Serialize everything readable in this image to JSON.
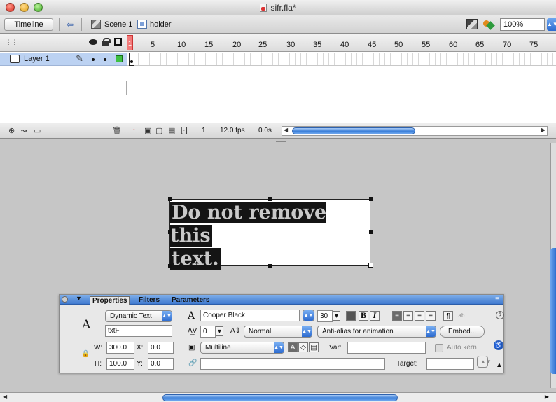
{
  "window": {
    "title": "sifr.fla*"
  },
  "nav": {
    "timeline_label": "Timeline",
    "breadcrumbs": [
      {
        "label": "Scene 1"
      },
      {
        "label": "holder"
      }
    ],
    "zoom": "100%"
  },
  "timeline": {
    "frame_numbers": [
      "1",
      "5",
      "10",
      "15",
      "20",
      "25",
      "30",
      "35",
      "40",
      "45",
      "50",
      "55",
      "60",
      "65",
      "70",
      "75"
    ],
    "layers": [
      {
        "name": "Layer 1"
      }
    ],
    "current_frame": "1",
    "frame_rate": "12.0 fps",
    "elapsed_time": "0.0s"
  },
  "stage": {
    "text_line1": "Do not remove this",
    "text_line2": "text."
  },
  "properties": {
    "tabs": [
      "Properties",
      "Filters",
      "Parameters"
    ],
    "text_type": "Dynamic Text",
    "instance_name": "txtF",
    "width_label": "W:",
    "width": "300.0",
    "height_label": "H:",
    "height": "100.0",
    "x_label": "X:",
    "x": "0.0",
    "y_label": "Y:",
    "y": "0.0",
    "font": "Cooper Black",
    "font_size": "30",
    "letter_spacing": "0",
    "char_position": "Normal",
    "anti_alias": "Anti-alias for animation",
    "embed_label": "Embed...",
    "line_type": "Multiline",
    "var_label": "Var:",
    "auto_kern_label": "Auto kern",
    "target_label": "Target:",
    "bold": "B",
    "italic": "I"
  },
  "colors": {
    "selection_bg": "#141414",
    "selected_text": "#c9c9c9",
    "layer_highlight": "#bcd2f2",
    "accent_blue": "#3b7fd8",
    "layer_color": "#3ec043",
    "playhead": "#e03030"
  }
}
